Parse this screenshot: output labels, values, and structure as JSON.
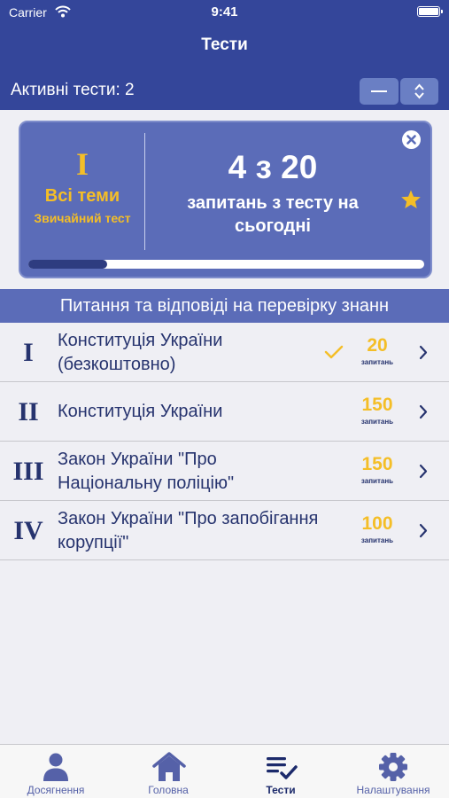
{
  "status_bar": {
    "carrier": "Carrier",
    "time": "9:41"
  },
  "nav": {
    "title": "Тести"
  },
  "toolbar": {
    "active_tests": "Активні тести: 2"
  },
  "card": {
    "roman": "I",
    "topic": "Всі теми",
    "mode": "Звичайний тест",
    "count": "4 з 20",
    "subtitle": "запитань з тесту на сьогодні",
    "progress": 0.2
  },
  "section": {
    "title": "Питання та відповіді на перевірку знанн"
  },
  "topics": [
    {
      "roman": "I",
      "title": "Конституція України (безкоштовно)",
      "count": "20",
      "unit": "запитань",
      "completed": true
    },
    {
      "roman": "II",
      "title": "Конституція України",
      "count": "150",
      "unit": "запитань",
      "completed": false
    },
    {
      "roman": "III",
      "title": "Закон України \"Про Національну поліцію\"",
      "count": "150",
      "unit": "запитань",
      "completed": false
    },
    {
      "roman": "IV",
      "title": "Закон України \"Про запобігання корупції\"",
      "count": "100",
      "unit": "запитань",
      "completed": false
    }
  ],
  "tabs": [
    {
      "label": "Досягнення",
      "icon": "person-icon",
      "active": false
    },
    {
      "label": "Головна",
      "icon": "home-icon",
      "active": false
    },
    {
      "label": "Тести",
      "icon": "checklist-icon",
      "active": true
    },
    {
      "label": "Налаштування",
      "icon": "gear-icon",
      "active": false
    }
  ],
  "colors": {
    "header": "#34469a",
    "card": "#5b6cb8",
    "accent": "#f4be27",
    "text": "#26336e"
  }
}
